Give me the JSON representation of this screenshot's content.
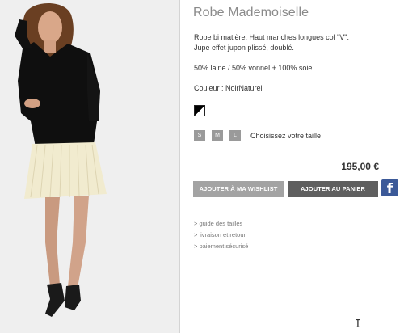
{
  "product": {
    "title": "Robe Mademoiselle",
    "description_line1": "Robe bi matière. Haut manches longues col \"V\".",
    "description_line2": "Jupe effet jupon plissé, doublé.",
    "composition": "50% laine / 50% vonnel + 100% soie",
    "colour_label": "Couleur : NoirNaturel"
  },
  "sizes": [
    "S",
    "M",
    "L"
  ],
  "size_hint": "Choisissez votre taille",
  "price": "195,00 €",
  "buttons": {
    "wishlist": "AJOUTER À MA WISHLIST",
    "cart": "AJOUTER AU PANIER",
    "facebook": "f"
  },
  "links": [
    "> guide des tailles",
    "> livraison et retour",
    "> paiement sécurisé"
  ],
  "cursor": "I",
  "colors": {
    "wishlist_button": "#a3a3a3",
    "cart_button": "#5f5f5f",
    "facebook": "#3b5998",
    "photo_background": "#efefef"
  }
}
